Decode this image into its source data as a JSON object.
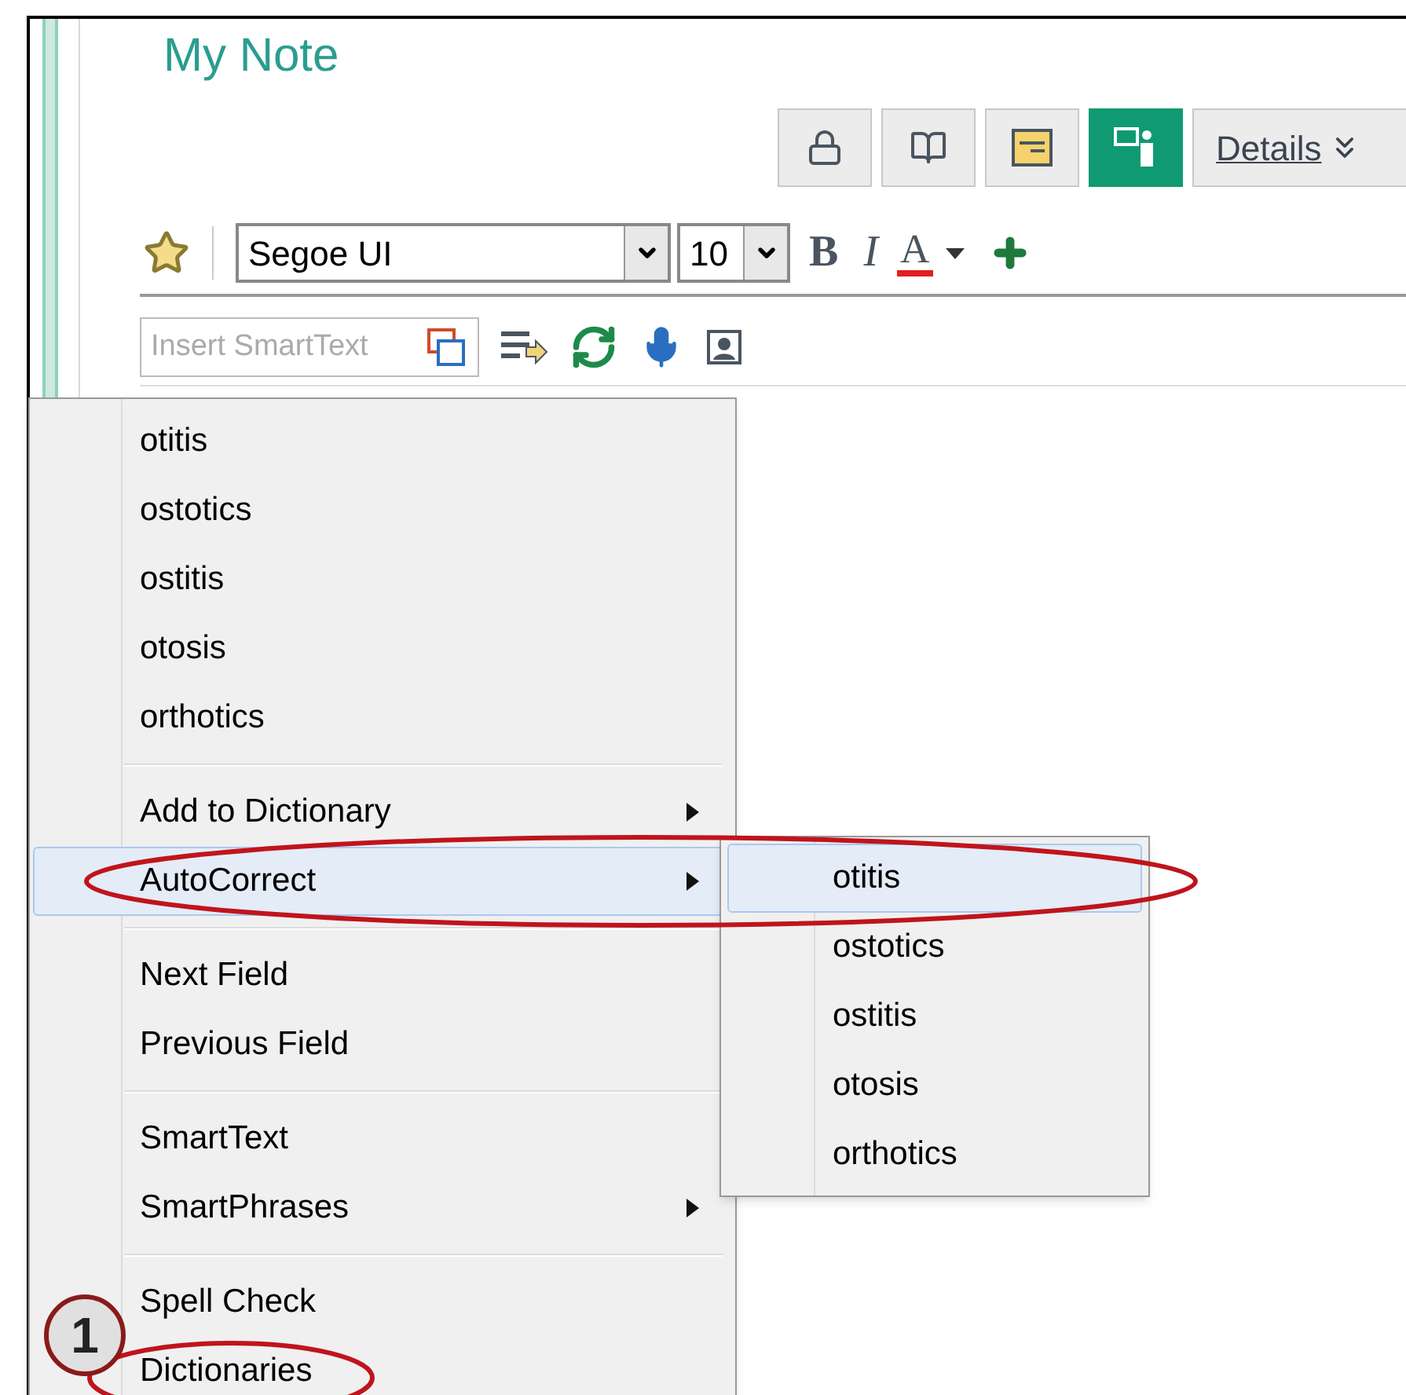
{
  "note": {
    "title": "My Note"
  },
  "toolbar": {
    "buttons": [
      {
        "kind": "lock",
        "selected": false
      },
      {
        "kind": "book",
        "selected": false
      },
      {
        "kind": "note",
        "selected": false
      },
      {
        "kind": "presenter",
        "selected": true
      }
    ],
    "details": "Details"
  },
  "format_bar": {
    "font": "Segoe UI",
    "size": "10",
    "bold": "B",
    "italic": "I",
    "text_color_label": "A"
  },
  "smarttext": {
    "placeholder": "Insert SmartText"
  },
  "context_menu": {
    "groups": [
      [
        {
          "label": "otitis",
          "submenu": false,
          "selected": false
        },
        {
          "label": "ostotics",
          "submenu": false,
          "selected": false
        },
        {
          "label": "ostitis",
          "submenu": false,
          "selected": false
        },
        {
          "label": "otosis",
          "submenu": false,
          "selected": false
        },
        {
          "label": "orthotics",
          "submenu": false,
          "selected": false
        }
      ],
      [
        {
          "label": "Add to Dictionary",
          "submenu": true,
          "selected": false
        },
        {
          "label": "AutoCorrect",
          "submenu": true,
          "selected": true
        }
      ],
      [
        {
          "label": "Next Field",
          "submenu": false,
          "selected": false
        },
        {
          "label": "Previous Field",
          "submenu": false,
          "selected": false
        }
      ],
      [
        {
          "label": "SmartText",
          "submenu": false,
          "selected": false
        },
        {
          "label": "SmartPhrases",
          "submenu": true,
          "selected": false
        }
      ],
      [
        {
          "label": "Spell Check",
          "submenu": false,
          "selected": false
        },
        {
          "label": "Dictionaries",
          "submenu": false,
          "selected": false
        }
      ]
    ]
  },
  "submenu": {
    "items": [
      {
        "label": "otitis",
        "selected": true
      },
      {
        "label": "ostotics",
        "selected": false
      },
      {
        "label": "ostitis",
        "selected": false
      },
      {
        "label": "otosis",
        "selected": false
      },
      {
        "label": "orthotics",
        "selected": false
      }
    ]
  },
  "callout": {
    "label": "1"
  }
}
